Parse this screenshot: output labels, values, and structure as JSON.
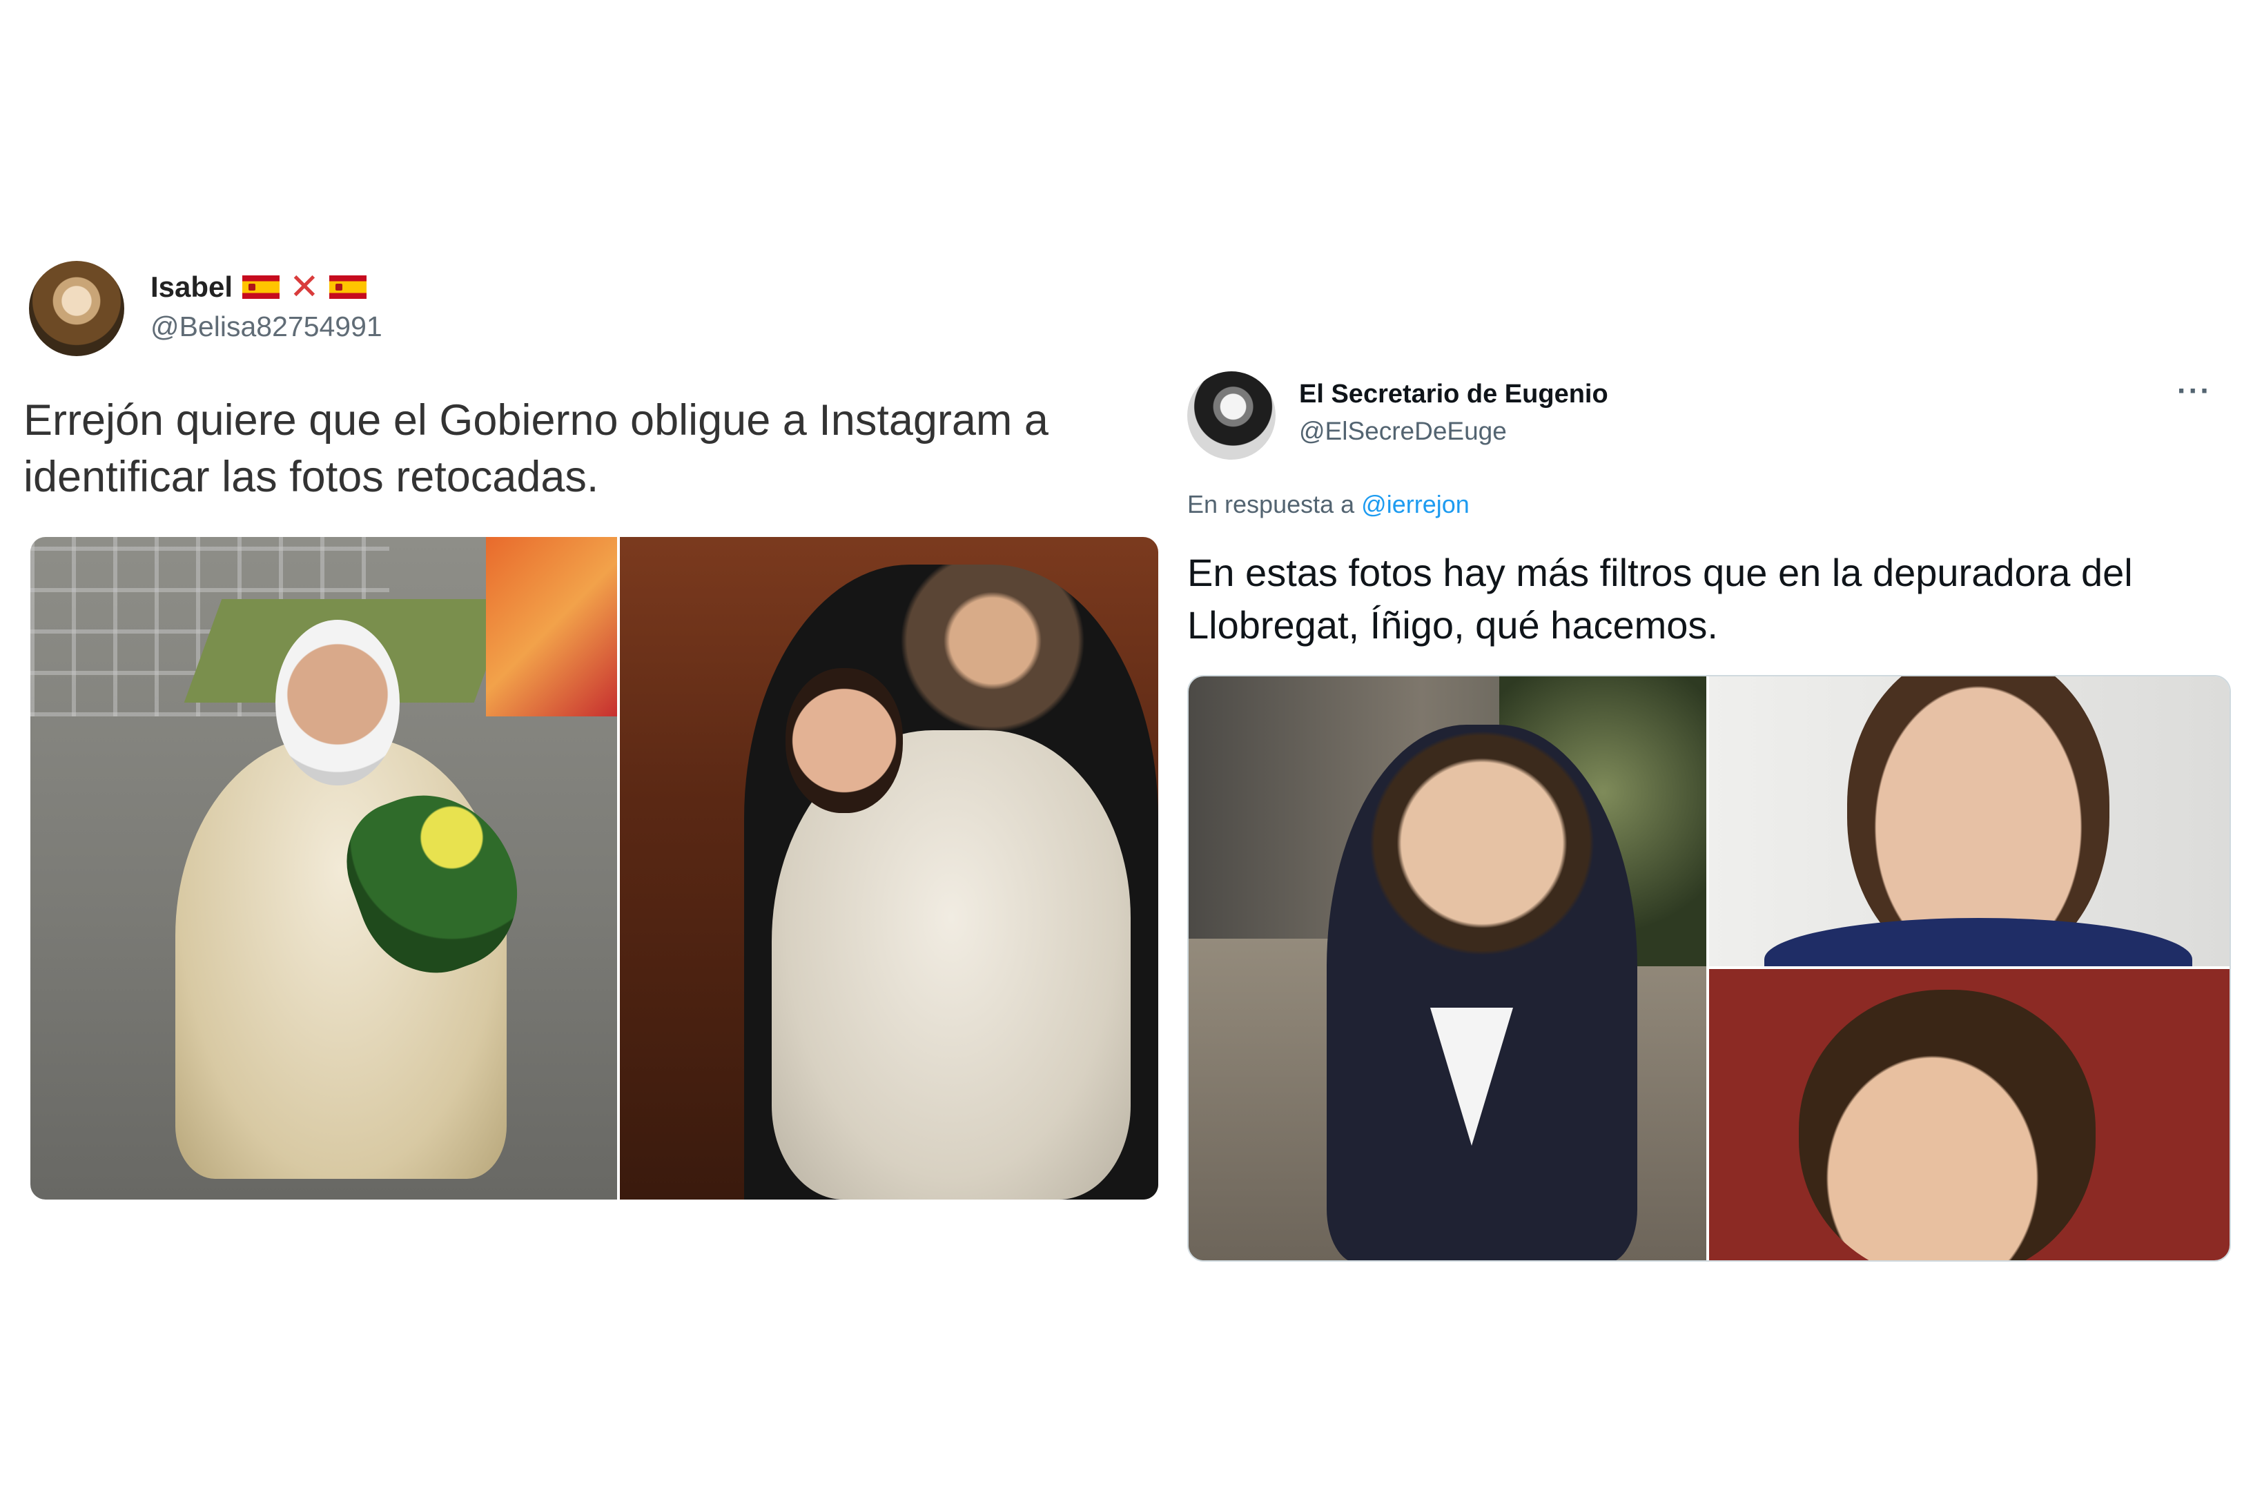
{
  "tweets": [
    {
      "display_name": "Isabel",
      "handle": "@Belisa82754991",
      "text": "Errejón quiere que el Gobierno obligue a Instagram a identificar las fotos retocadas.",
      "name_badges": [
        "spain-flag-icon",
        "red-x-icon",
        "spain-flag-icon"
      ],
      "cross_symbol": "✕",
      "photo_count": 2
    },
    {
      "display_name": "El Secretario de Eugenio",
      "handle": "@ElSecreDeEuge",
      "more_label": "···",
      "reply_prefix": "En respuesta a",
      "reply_mention": "@ierrejon",
      "text": "En estas fotos hay más filtros que en la depuradora del Llobregat, Íñigo, qué hacemos.",
      "photo_count": 3
    }
  ],
  "colors": {
    "mention": "#1d9bf0",
    "secondary_text": "#536471",
    "primary_text": "#0f1419"
  }
}
